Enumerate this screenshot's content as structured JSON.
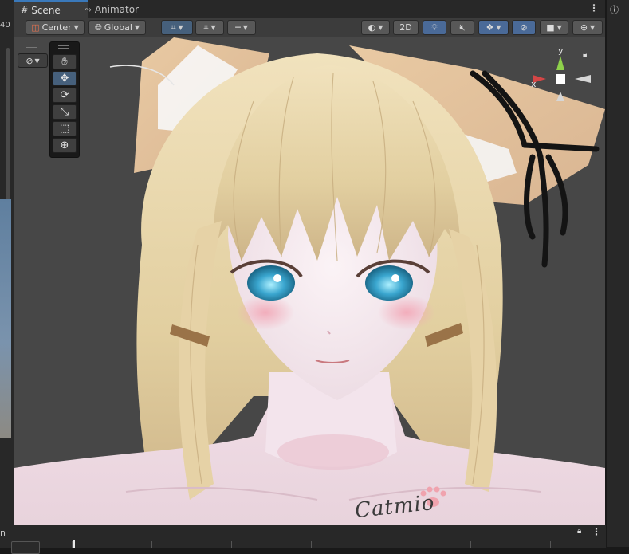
{
  "left_strip": {
    "number": "40"
  },
  "tabs": [
    {
      "label": "Scene",
      "icon": "grid-icon"
    },
    {
      "label": "Animator",
      "icon": "animator-icon"
    }
  ],
  "toolbar": {
    "pivot_mode": "Center",
    "pivot_rotation": "Global",
    "mode_2d": "2D"
  },
  "gizmo": {
    "x_label": "x",
    "y_label": "y"
  },
  "watermark": "Catmio",
  "colors": {
    "accent": "#3a79bb",
    "active_tool": "#46607c",
    "scene_bg": "#474747",
    "hair": "#e9d7ae"
  }
}
